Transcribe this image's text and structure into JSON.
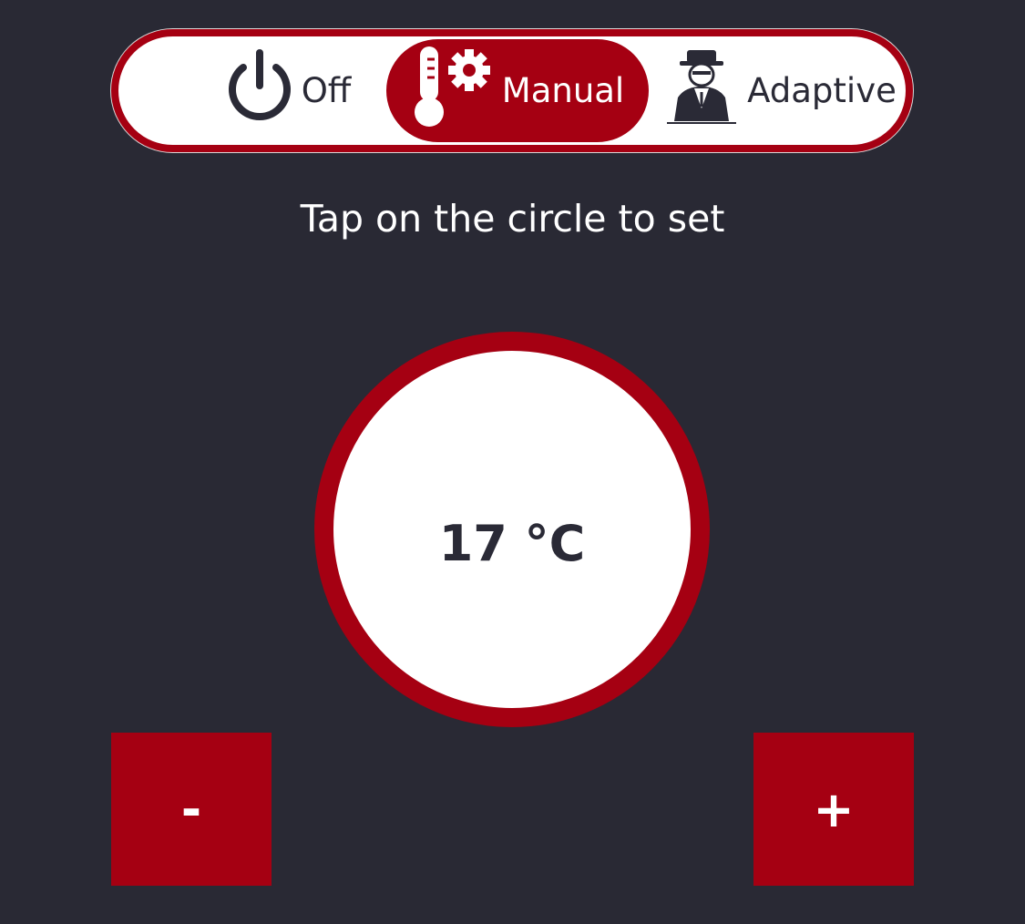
{
  "mode_selector": {
    "off": {
      "label": "Off",
      "icon": "power-icon"
    },
    "manual": {
      "label": "Manual",
      "icon": "thermometer-gear-icon",
      "selected": true
    },
    "adaptive": {
      "label": "Adaptive",
      "icon": "detective-icon"
    }
  },
  "hint": "Tap on the circle to set",
  "temperature": {
    "display": "17 °C"
  },
  "controls": {
    "decrease_label": "-",
    "increase_label": "+"
  },
  "colors": {
    "accent": "#A50012",
    "background": "#292934",
    "text_dark": "#2A2A36"
  }
}
